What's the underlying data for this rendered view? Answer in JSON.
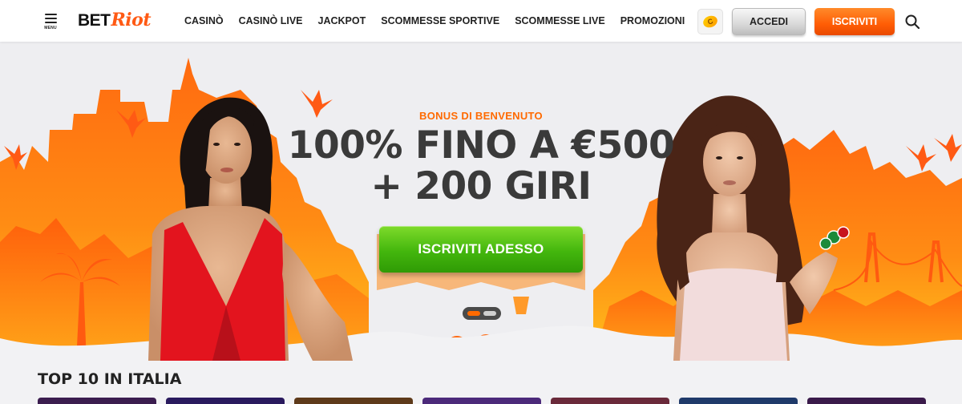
{
  "header": {
    "menu_label": "MENU",
    "logo": {
      "bet": "BET",
      "riot": "Riot"
    },
    "nav": [
      {
        "label": "CASINÒ"
      },
      {
        "label": "CASINÒ LIVE"
      },
      {
        "label": "JACKPOT"
      },
      {
        "label": "SCOMMESSE SPORTIVE"
      },
      {
        "label": "SCOMMESSE LIVE"
      },
      {
        "label": "PROMOZIONI"
      }
    ],
    "login_label": "ACCEDI",
    "signup_label": "ISCRIVITI"
  },
  "hero": {
    "bonus_label": "BONUS DI BENVENUTO",
    "headline_line1": "100% FINO A €500",
    "headline_line2": "+ 200 GIRI",
    "cta_label": "ISCRIVITI ADESSO",
    "carousel": {
      "slides": 2,
      "active": 1
    }
  },
  "section": {
    "title": "TOP 10 IN ITALIA"
  },
  "colors": {
    "accent": "#ff5a14",
    "cta": "#43b60d",
    "text_dark": "#3a3a3a",
    "hero_orange": "#ff7a12",
    "hero_yellow": "#ffc21c"
  },
  "card_colors": [
    "#3b1d4f",
    "#2a1a5e",
    "#5e3a1a",
    "#4c2a7a",
    "#6a2a3a",
    "#1f3a6a",
    "#3a1a4a"
  ]
}
